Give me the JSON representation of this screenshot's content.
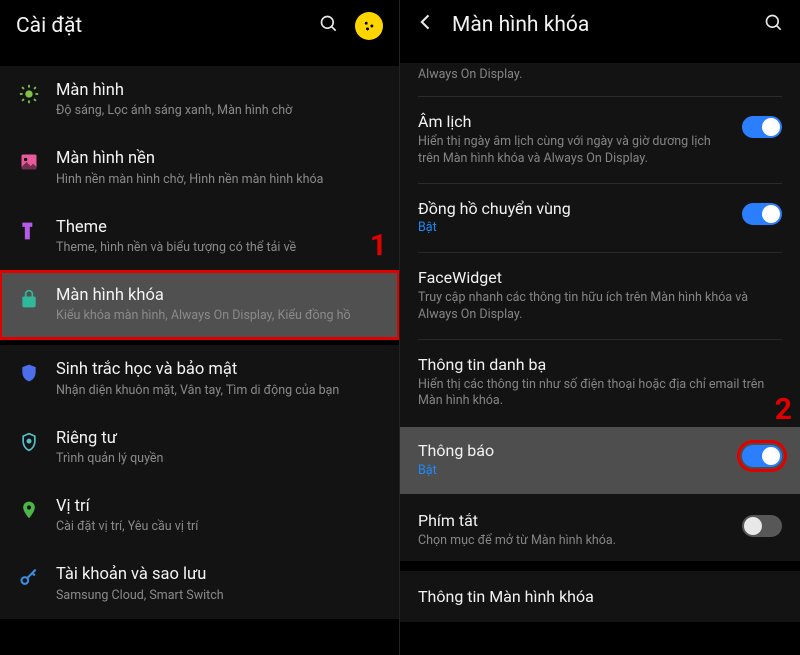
{
  "left": {
    "title": "Cài đặt",
    "items": [
      {
        "icon": "brightness",
        "title": "Màn hình",
        "sub": "Độ sáng, Lọc ánh sáng xanh, Màn hình chờ"
      },
      {
        "icon": "wallpaper",
        "title": "Màn hình nền",
        "sub": "Hình nền màn hình chờ, Hình nền màn hình khóa"
      },
      {
        "icon": "theme",
        "title": "Theme",
        "sub": "Theme, hình nền và biểu tượng có thể tải về"
      },
      {
        "icon": "lock",
        "title": "Màn hình khóa",
        "sub": "Kiểu khóa màn hình, Always On Display, Kiểu đồng hồ",
        "highlight": true
      }
    ],
    "items2": [
      {
        "icon": "shield",
        "title": "Sinh trắc học và bảo mật",
        "sub": "Nhận diện khuôn mặt, Vân tay, Tìm di động của bạn"
      },
      {
        "icon": "privacy",
        "title": "Riêng tư",
        "sub": "Trình quản lý quyền"
      },
      {
        "icon": "location",
        "title": "Vị trí",
        "sub": "Cài đặt vị trí, Yêu cầu vị trí"
      },
      {
        "icon": "key",
        "title": "Tài khoản và sao lưu",
        "sub": "Samsung Cloud, Smart Switch"
      }
    ]
  },
  "right": {
    "title": "Màn hình khóa",
    "prev_sub": "Always On Display.",
    "rows": [
      {
        "title": "Âm lịch",
        "sub": "Hiển thị ngày âm lịch cùng với ngày và giờ dương lịch trên Màn hình khóa và Always On Display.",
        "toggle": true,
        "on": true
      },
      {
        "title": "Đồng hồ chuyển vùng",
        "on_label": "Bật",
        "toggle": true,
        "on": true
      },
      {
        "title": "FaceWidget",
        "sub": "Truy cập nhanh các thông tin hữu ích trên Màn hình khóa và Always On Display."
      },
      {
        "title": "Thông tin danh bạ",
        "sub": "Hiển thị các thông tin như số điện thoại hoặc địa chỉ email trên Màn hình khóa."
      },
      {
        "title": "Thông báo",
        "on_label": "Bật",
        "toggle": true,
        "on": true,
        "highlight": true
      },
      {
        "title": "Phím tắt",
        "sub": "Chọn mục để mở từ Màn hình khóa.",
        "toggle": true,
        "on": false
      }
    ],
    "footer": "Thông tin Màn hình khóa"
  },
  "badges": {
    "one": "1",
    "two": "2"
  }
}
